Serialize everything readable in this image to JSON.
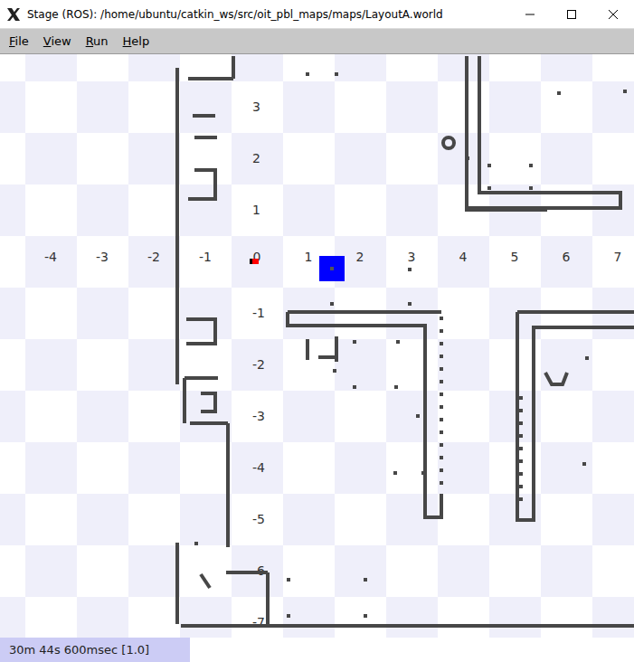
{
  "window": {
    "title": "Stage (ROS): /home/ubuntu/catkin_ws/src/oit_pbl_maps/maps/LayoutA.world"
  },
  "menu": [
    "File",
    "View",
    "Run",
    "Help"
  ],
  "axes": {
    "x_ticks": [
      "-4",
      "-3",
      "-2",
      "-1",
      "0",
      "1",
      "2",
      "3",
      "4",
      "5",
      "6",
      "7"
    ],
    "y_ticks": [
      "3",
      "2",
      "1",
      "-1",
      "-2",
      "-3",
      "-4",
      "-5",
      "-6",
      "-7"
    ]
  },
  "robots": [
    {
      "color": "#0000ff"
    },
    {
      "color": "#ff0000"
    }
  ],
  "status_bar": {
    "time": "30m 44s 600msec [1.0]"
  }
}
